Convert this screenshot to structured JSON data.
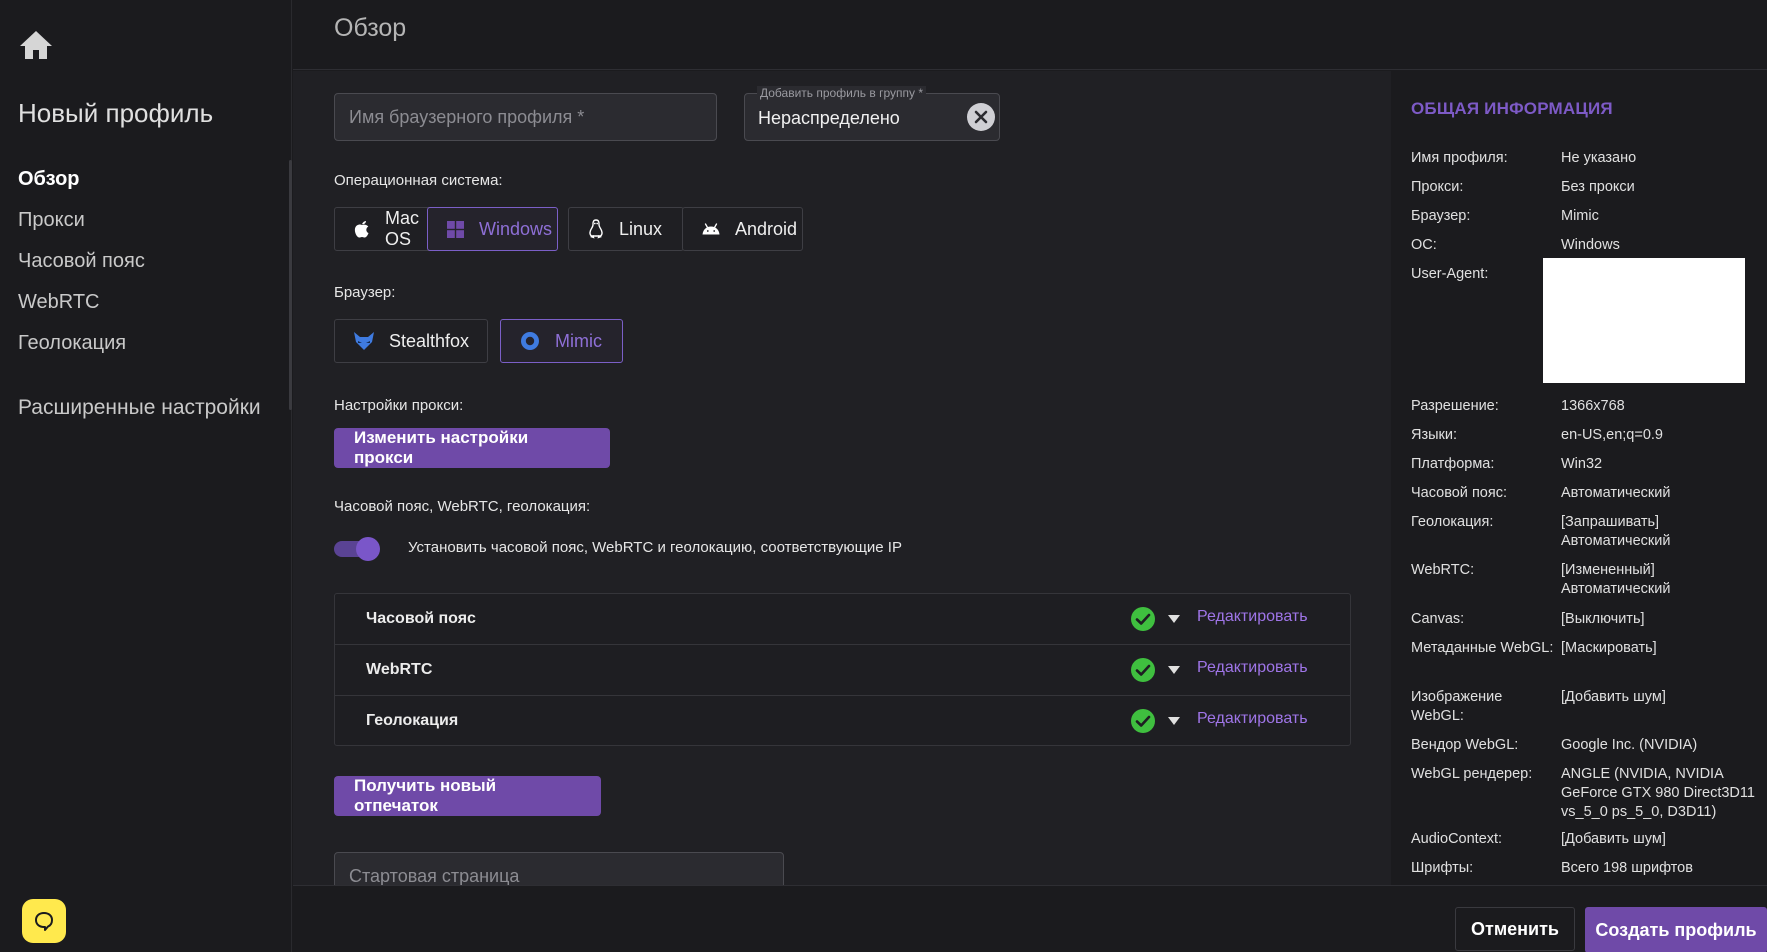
{
  "sidebar": {
    "title": "Новый профиль",
    "items": [
      {
        "label": "Обзор",
        "active": true
      },
      {
        "label": "Прокси"
      },
      {
        "label": "Часовой пояс"
      },
      {
        "label": "WebRTC"
      },
      {
        "label": "Геолокация"
      }
    ],
    "advanced": "Расширенные настройки"
  },
  "header": {
    "title": "Обзор"
  },
  "form": {
    "profile_name_placeholder": "Имя браузерного профиля *",
    "group_label": "Добавить профиль в группу *",
    "group_value": "Нераспределено",
    "os_label": "Операционная система:",
    "os_options": [
      "Mac OS",
      "Windows",
      "Linux",
      "Android"
    ],
    "os_selected": "Windows",
    "browser_label": "Браузер:",
    "browser_options": [
      "Stealthfox",
      "Mimic"
    ],
    "browser_selected": "Mimic",
    "proxy_label": "Настройки прокси:",
    "proxy_button": "Изменить настройки прокси",
    "tz_label": "Часовой пояс, WebRTC, геолокация:",
    "tz_toggle_text": "Установить часовой пояс, WebRTC и геолокацию, соответствующие IP",
    "tz_toggle_on": true,
    "checks": [
      {
        "title": "Часовой пояс",
        "edit": "Редактировать"
      },
      {
        "title": "WebRTC",
        "edit": "Редактировать"
      },
      {
        "title": "Геолокация",
        "edit": "Редактировать"
      }
    ],
    "fingerprint_button": "Получить новый отпечаток",
    "start_page_placeholder": "Стартовая страница"
  },
  "info": {
    "heading": "ОБЩАЯ ИНФОРМАЦИЯ",
    "rows": [
      {
        "key": "Имя профиля:",
        "value": "Не указано"
      },
      {
        "key": "Прокси:",
        "value": "Без прокси"
      },
      {
        "key": "Браузер:",
        "value": "Mimic"
      },
      {
        "key": "ОС:",
        "value": "Windows"
      },
      {
        "key": "User-Agent:",
        "value": ""
      },
      {
        "key": "Разрешение:",
        "value": "1366x768"
      },
      {
        "key": "Языки:",
        "value": "en-US,en;q=0.9"
      },
      {
        "key": "Платформа:",
        "value": "Win32"
      },
      {
        "key": "Часовой пояс:",
        "value": "Автоматический"
      },
      {
        "key": "Геолокация:",
        "value": "[Запрашивать] Автоматический"
      },
      {
        "key": "WebRTC:",
        "value": "[Измененный] Автоматический"
      },
      {
        "key": "Canvas:",
        "value": "[Выключить]"
      },
      {
        "key": "Метаданные WebGL:",
        "value": "[Маскировать]"
      },
      {
        "key": "Изображение WebGL:",
        "value": "[Добавить шум]"
      },
      {
        "key": "Вендор WebGL:",
        "value": "Google Inc. (NVIDIA)"
      },
      {
        "key": "WebGL рендерер:",
        "value": "ANGLE (NVIDIA, NVIDIA GeForce GTX 980 Direct3D11 vs_5_0 ps_5_0, D3D11)"
      },
      {
        "key": "AudioContext:",
        "value": "[Добавить шум]"
      },
      {
        "key": "Шрифты:",
        "value": "Всего 198 шрифтов"
      }
    ]
  },
  "footer": {
    "cancel": "Отменить",
    "create": "Создать профиль"
  },
  "colors": {
    "accent": "#6f4aa8",
    "accent_text": "#9f75e8",
    "success": "#3fbf3f",
    "chat": "#ffe94d"
  }
}
